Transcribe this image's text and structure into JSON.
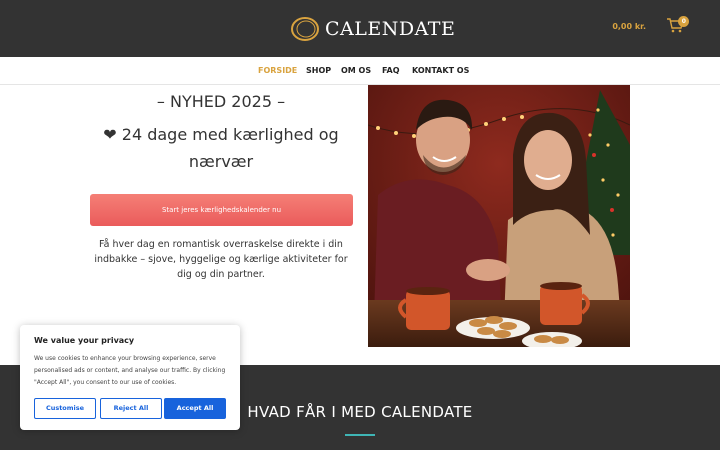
{
  "header": {
    "logo_text": "CALENDATE",
    "cart_amount": "0,00 kr.",
    "cart_count": "0",
    "accent_color": "#d9a33f"
  },
  "nav": {
    "items": [
      {
        "label": "FORSIDE",
        "active": true
      },
      {
        "label": "SHOP"
      },
      {
        "label": "OM OS"
      },
      {
        "label": "FAQ"
      },
      {
        "label": "KONTAKT OS"
      }
    ]
  },
  "hero": {
    "title": "– NYHED 2025 –",
    "subtitle": "❤ 24 dage med kærlighed og nærvær",
    "cta_label": "Start jeres kærlighedskalender nu",
    "description": "Få hver dag en romantisk overraskelse direkte i din indbakke – sjove, hyggelige og kærlige aktiviteter for dig og din partner."
  },
  "section": {
    "title": "HVAD FÅR I MED CALENDATE"
  },
  "cookie_banner": {
    "title": "We value your privacy",
    "text": "We use cookies to enhance your browsing experience, serve personalised ads or content, and analyse our traffic. By clicking \"Accept All\", you consent to our use of cookies.",
    "customise_label": "Customise",
    "reject_label": "Reject All",
    "accept_label": "Accept All",
    "button_color": "#1863dc"
  }
}
